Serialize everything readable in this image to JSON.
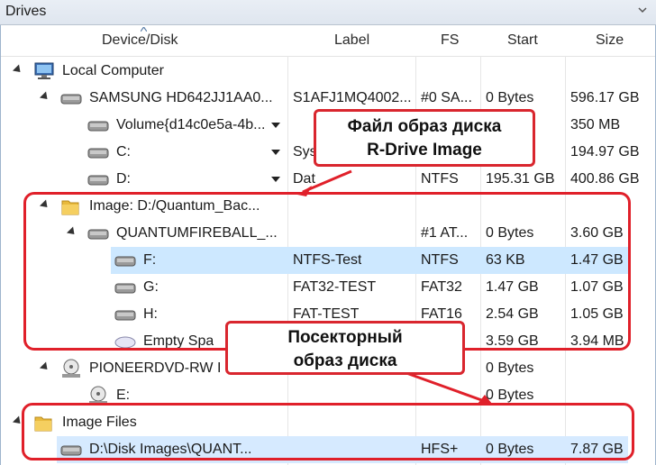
{
  "window": {
    "title": "Drives"
  },
  "columns": [
    "Device/Disk",
    "Label",
    "FS",
    "Start",
    "Size"
  ],
  "rows": [
    {
      "name": "Local Computer",
      "label": "",
      "fs": "",
      "start": "",
      "size": ""
    },
    {
      "name": "SAMSUNG HD642JJ1AA0...",
      "label": "S1AFJ1MQ4002...",
      "fs": "#0 SA...",
      "start": "0 Bytes",
      "size": "596.17 GB"
    },
    {
      "name": "Volume{d14c0e5a-4b...",
      "label": "",
      "fs": "",
      "start": "",
      "size": "350 MB"
    },
    {
      "name": "C:",
      "label": "Sys",
      "fs": "",
      "start": "",
      "size": "194.97 GB"
    },
    {
      "name": "D:",
      "label": "Dat",
      "fs": "NTFS",
      "start": "195.31 GB",
      "size": "400.86 GB"
    },
    {
      "name": "Image: D:/Quantum_Bac...",
      "label": "",
      "fs": "",
      "start": "",
      "size": ""
    },
    {
      "name": "QUANTUMFIREBALL_...",
      "label": "",
      "fs": "#1 AT...",
      "start": "0 Bytes",
      "size": "3.60 GB"
    },
    {
      "name": "F:",
      "label": "NTFS-Test",
      "fs": "NTFS",
      "start": "63 KB",
      "size": "1.47 GB"
    },
    {
      "name": "G:",
      "label": "FAT32-TEST",
      "fs": "FAT32",
      "start": "1.47 GB",
      "size": "1.07 GB"
    },
    {
      "name": "H:",
      "label": "FAT-TEST",
      "fs": "FAT16",
      "start": "2.54 GB",
      "size": "1.05 GB"
    },
    {
      "name": "Empty Spa",
      "label": "",
      "fs": "",
      "start": "3.59 GB",
      "size": "3.94 MB"
    },
    {
      "name": "PIONEERDVD-RW I",
      "label": "",
      "fs": "",
      "start": "0 Bytes",
      "size": ""
    },
    {
      "name": "E:",
      "label": "",
      "fs": "",
      "start": "0 Bytes",
      "size": ""
    },
    {
      "name": "Image Files",
      "label": "",
      "fs": "",
      "start": "",
      "size": ""
    },
    {
      "name": "D:\\Disk Images\\QUANT...",
      "label": "",
      "fs": "HFS+",
      "start": "0 Bytes",
      "size": "7.87 GB"
    }
  ],
  "callouts": {
    "top_line1": "Файл образ диска",
    "top_line2": "R-Drive Image",
    "bottom_line1": "Посекторный",
    "bottom_line2": "образ диска"
  },
  "icons": {
    "computer": "computer-icon",
    "disk": "hard-disk-icon",
    "folder": "folder-icon",
    "dvd": "dvd-drive-icon"
  },
  "colors": {
    "annotation_red": "#e0202a",
    "selection": "#cde8ff"
  }
}
